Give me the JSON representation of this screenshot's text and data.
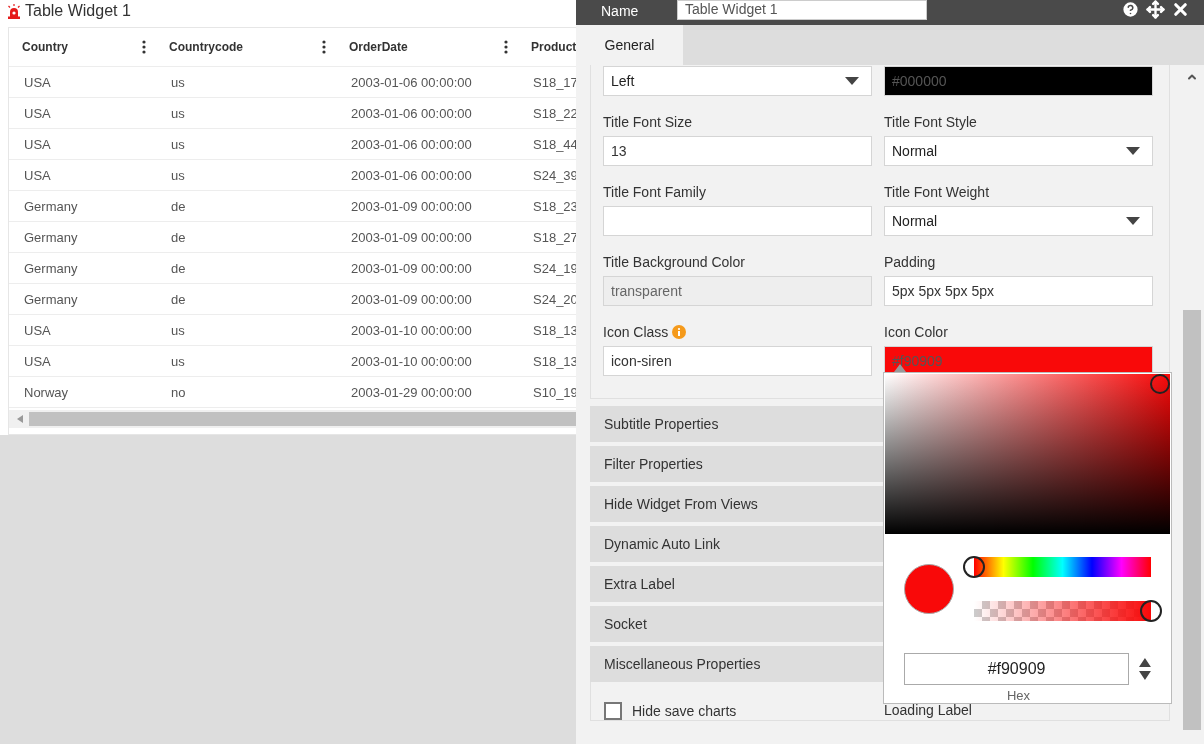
{
  "widget": {
    "title": "Table Widget 1",
    "table": {
      "columns": [
        "Country",
        "Countrycode",
        "OrderDate",
        "Product"
      ],
      "rows": [
        [
          "USA",
          "us",
          "2003-01-06 00:00:00",
          "S18_17"
        ],
        [
          "USA",
          "us",
          "2003-01-06 00:00:00",
          "S18_22"
        ],
        [
          "USA",
          "us",
          "2003-01-06 00:00:00",
          "S18_44"
        ],
        [
          "USA",
          "us",
          "2003-01-06 00:00:00",
          "S24_39"
        ],
        [
          "Germany",
          "de",
          "2003-01-09 00:00:00",
          "S18_23"
        ],
        [
          "Germany",
          "de",
          "2003-01-09 00:00:00",
          "S18_27"
        ],
        [
          "Germany",
          "de",
          "2003-01-09 00:00:00",
          "S24_19"
        ],
        [
          "Germany",
          "de",
          "2003-01-09 00:00:00",
          "S24_20"
        ],
        [
          "USA",
          "us",
          "2003-01-10 00:00:00",
          "S18_13"
        ],
        [
          "USA",
          "us",
          "2003-01-10 00:00:00",
          "S18_13"
        ],
        [
          "Norway",
          "no",
          "2003-01-29 00:00:00",
          "S10_19"
        ]
      ]
    }
  },
  "panel": {
    "name_label": "Name",
    "name_value": "Table Widget 1",
    "tabs": [
      {
        "label": "General",
        "selected": true
      }
    ],
    "fields": [
      {
        "kind": "select",
        "value": "Left"
      },
      {
        "kind": "color",
        "value": "#000000",
        "color": "#000000"
      },
      {
        "kind": "text",
        "label": "Title Font Size",
        "value": "13"
      },
      {
        "kind": "select",
        "label": "Title Font Style",
        "value": "Normal"
      },
      {
        "kind": "text",
        "label": "Title Font Family"
      },
      {
        "kind": "select",
        "label": "Title Font Weight",
        "value": "Normal"
      },
      {
        "kind": "text",
        "label": "Title Background Color",
        "value": "transparent",
        "disabled": true
      },
      {
        "kind": "text",
        "label": "Padding",
        "value": "5px 5px 5px 5px"
      },
      {
        "kind": "text",
        "label": "Icon Class",
        "value": "icon-siren",
        "info": true
      },
      {
        "kind": "color",
        "label": "Icon Color",
        "value": "#f90909",
        "color": "#f90909"
      }
    ],
    "sections": [
      "Subtitle Properties",
      "Filter Properties",
      "Hide Widget From Views",
      "Dynamic Auto Link",
      "Extra Label",
      "Socket",
      "Miscellaneous Properties"
    ],
    "checkboxes": [
      {
        "label": "Hide save charts",
        "checked": false
      }
    ],
    "loading_label": "Loading Label",
    "color_picker": {
      "color": "#f90909",
      "hue": {
        "level": 0
      },
      "alpha": {
        "level": 1
      },
      "hex": "#f90909",
      "hex_label": "Hex"
    }
  }
}
